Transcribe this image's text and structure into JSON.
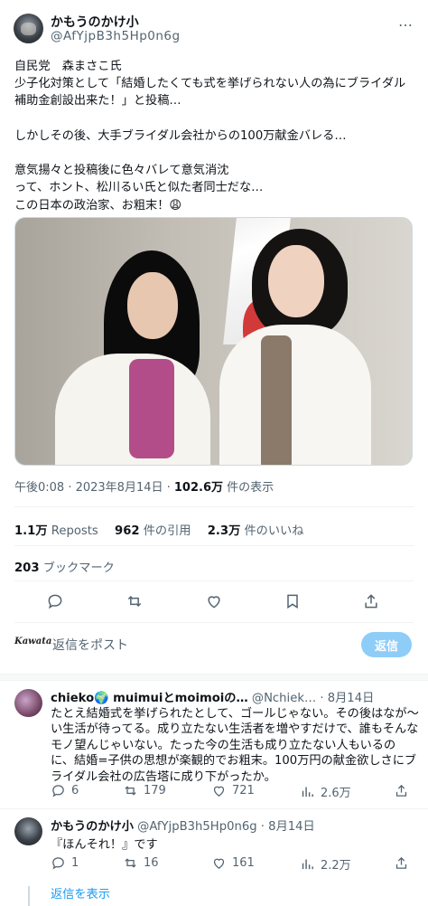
{
  "tweet": {
    "author_name": "かもうのかけ小",
    "author_handle": "@AfYjpB3h5Hp0n6g",
    "more": "…",
    "text": "自民党　森まさこ氏\n少子化対策として「結婚したくても式を挙げられない人の為にブライダル補助金創設出来た！」と投稿…\n\nしかしその後、大手ブライダル会社からの100万献金バレる…\n\n意気揚々と投稿後に色々バレて意気消沈\nって、ホント、松川るい氏と似た者同士だな…\nこの日本の政治家、お粗末！😩",
    "time": "午後0:08 · 2023年8月14日 · ",
    "views_count": "102.6万",
    "views_label": " 件の表示",
    "reposts_count": "1.1万",
    "reposts_label": "Reposts",
    "quotes_count": "962",
    "quotes_label": "件の引用",
    "likes_count": "2.3万",
    "likes_label": "件のいいね",
    "bookmarks_count": "203",
    "bookmarks_label": "ブックマーク"
  },
  "composer": {
    "avatar_text": "Kawata",
    "placeholder": "返信をポスト",
    "button": "返信"
  },
  "replies": [
    {
      "name": "chieko🌍 muimuiとmoimoiの…",
      "handle": "@Nchiek…",
      "date": "· 8月14日",
      "text": "たとえ結婚式を挙げられたとして、ゴールじゃない。その後はなが〜い生活が待ってる。成り立たない生活者を増やすだけで、誰もそんなモノ望んじゃいない。たった今の生活も成り立たない人もいるのに、結婚=子供の思想が楽観的でお粗末。100万円の献金欲しさにブライダル会社の広告塔に成り下がったか。",
      "replies": "6",
      "reposts": "179",
      "likes": "721",
      "views": "2.6万"
    },
    {
      "name": "かもうのかけ小",
      "handle": "@AfYjpB3h5Hp0n6g",
      "date": "· 8月14日",
      "text": "『ほんそれ！』です",
      "replies": "1",
      "reposts": "16",
      "likes": "161",
      "views": "2.2万"
    }
  ],
  "show_replies": "返信を表示",
  "colors": {
    "accent": "#1d9bf0",
    "muted": "#536471",
    "reply_button": "#8ecdf8"
  },
  "icons": [
    "reply-icon",
    "repost-icon",
    "like-icon",
    "bookmark-icon",
    "share-icon",
    "views-icon",
    "more-icon"
  ]
}
